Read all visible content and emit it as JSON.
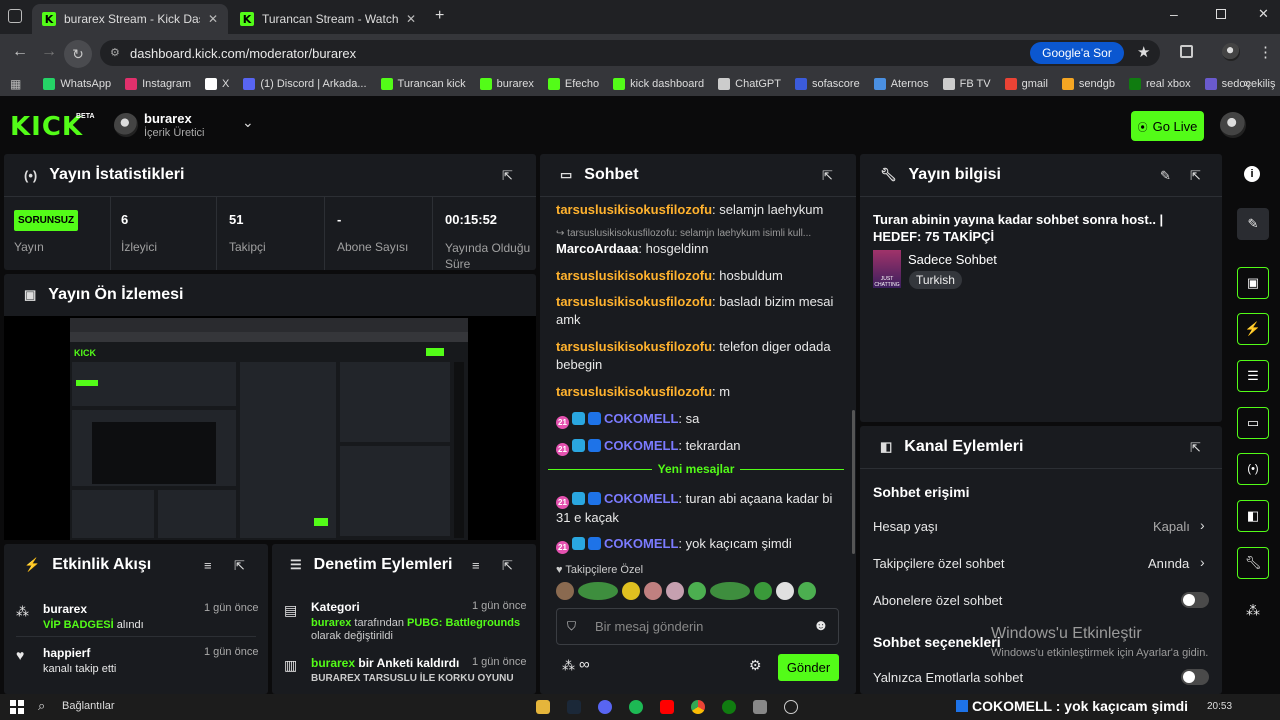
{
  "browser": {
    "tabs": [
      {
        "label": "burarex Stream - Kick Dashboard"
      },
      {
        "label": "Turancan Stream - Watch Live on Kick"
      }
    ],
    "new_tab": "+",
    "url": "dashboard.kick.com/moderator/burarex",
    "google_button": "Google'a Sor"
  },
  "bookmarks": [
    {
      "label": "WhatsApp",
      "color": "#25d366"
    },
    {
      "label": "Instagram",
      "color": "#e1306c"
    },
    {
      "label": "X",
      "color": "#ffffff"
    },
    {
      "label": "(1) Discord | Arkada...",
      "color": "#5865f2"
    },
    {
      "label": "Turancan kick",
      "color": "#53fc18"
    },
    {
      "label": "burarex",
      "color": "#53fc18"
    },
    {
      "label": "Efecho",
      "color": "#53fc18"
    },
    {
      "label": "kick dashboard",
      "color": "#53fc18"
    },
    {
      "label": "ChatGPT",
      "color": "#cccccc"
    },
    {
      "label": "sofascore",
      "color": "#3b5bdb"
    },
    {
      "label": "Aternos",
      "color": "#4a90e2"
    },
    {
      "label": "FB TV",
      "color": "#cccccc"
    },
    {
      "label": "gmail",
      "color": "#ea4335"
    },
    {
      "label": "sendgb",
      "color": "#f5a623"
    },
    {
      "label": "real xbox",
      "color": "#107c10"
    },
    {
      "label": "sedoçekiliş",
      "color": "#6a5acd"
    }
  ],
  "header": {
    "logo": "KICK",
    "beta": "BETA",
    "username": "burarex",
    "role": "İçerik Üretici",
    "go_live": "Go Live"
  },
  "stats": {
    "title": "Yayın İstatistikleri",
    "status": "SORUNSUZ",
    "status_label": "Yayın",
    "viewers": "6",
    "viewers_label": "İzleyici",
    "followers": "51",
    "followers_label": "Takipçi",
    "subs": "-",
    "subs_label": "Abone Sayısı",
    "uptime": "00:15:52",
    "uptime_label": "Yayında Olduğu Süre"
  },
  "preview": {
    "title": "Yayın Ön İzlemesi"
  },
  "activity": {
    "title": "Etkinlik Akışı",
    "items": [
      {
        "user": "burarex",
        "detail": "VİP BADGESİ",
        "suffix": " alındı",
        "time": "1 gün önce"
      },
      {
        "user": "happierf",
        "detail": "kanalı takip etti",
        "time": "1 gün önce"
      }
    ]
  },
  "moderation": {
    "title": "Denetim Eylemleri",
    "items": [
      {
        "title": "Kategori",
        "time": "1 gün önce",
        "user": "burarex",
        "mid": " tarafından ",
        "cat": "PUBG: Battlegrounds",
        "tail": "olarak değiştirildi"
      },
      {
        "user": "burarex",
        "mid": " bir Anketi kaldırdı",
        "time": "1 gün önce",
        "tail": "BURAREX TARSUSLU İLE KORKU OYUNU"
      }
    ]
  },
  "chat": {
    "title": "Sohbet",
    "messages": [
      {
        "user": "tarsuslusikisokusfilozofu",
        "text": ": selamjn laehykum"
      },
      {
        "reply": "tarsuslusikisokusfilozofu: selamjn laehykum isimli kull..."
      },
      {
        "user": "MarcoArdaaa",
        "text": ": hosgeldinn",
        "color": "#ffffff"
      },
      {
        "user": "tarsuslusikisokusfilozofu",
        "text": ": hosbuldum"
      },
      {
        "user": "tarsuslusikisokusfilozofu",
        "text": ": basladı bizim mesai amk"
      },
      {
        "user": "tarsuslusikisokusfilozofu",
        "text": ": telefon diger odada bebegin"
      },
      {
        "user": "tarsuslusikisokusfilozofu",
        "text": ": m"
      },
      {
        "user": "COKOMELL",
        "text": ": sa",
        "badges": true
      },
      {
        "user": "COKOMELL",
        "text": ": tekrardan",
        "badges": true
      }
    ],
    "new_messages": "Yeni mesajlar",
    "new": [
      {
        "user": "COKOMELL",
        "text": ": turan abi açaana kadar bi 31 e kaçak",
        "badges": true
      },
      {
        "user": "COKOMELL",
        "text": ": yok kaçıcam şimdi",
        "badges": true
      }
    ],
    "followers_only": "Takipçilere Özel",
    "placeholder": "Bir mesaj gönderin",
    "send": "Gönder",
    "badge_num": "21"
  },
  "info": {
    "title": "Yayın bilgisi",
    "stream_title": "Turan abinin yayına kadar sohbet sonra host.. | HEDEF: 75 TAKİPÇİ",
    "category": "Sadece Sohbet",
    "tag": "Turkish",
    "thumb": "JUST CHATTING"
  },
  "actions": {
    "title": "Kanal Eylemleri",
    "section1": "Sohbet erişimi",
    "rows": [
      {
        "label": "Hesap yaşı",
        "value": "Kapalı"
      },
      {
        "label": "Takipçilere özel sohbet",
        "value": "Anında"
      },
      {
        "label": "Abonelere özel sohbet"
      }
    ],
    "section2": "Sohbet seçenekleri",
    "rows2": [
      {
        "label": "Yalnızca Emotlarla sohbet"
      }
    ]
  },
  "watermark": {
    "line1": "Windows'u Etkinleştir",
    "line2": "Windows'u etkinleştirmek için Ayarlar'a gidin."
  },
  "taskbar": {
    "search": "Bağlantılar",
    "ticker": "COKOMELL : yok kaçıcam şimdi",
    "time": "20:53"
  },
  "colors": {
    "accent": "#53fc18",
    "username": "#ffb22e",
    "subname": "#7b7bff"
  }
}
